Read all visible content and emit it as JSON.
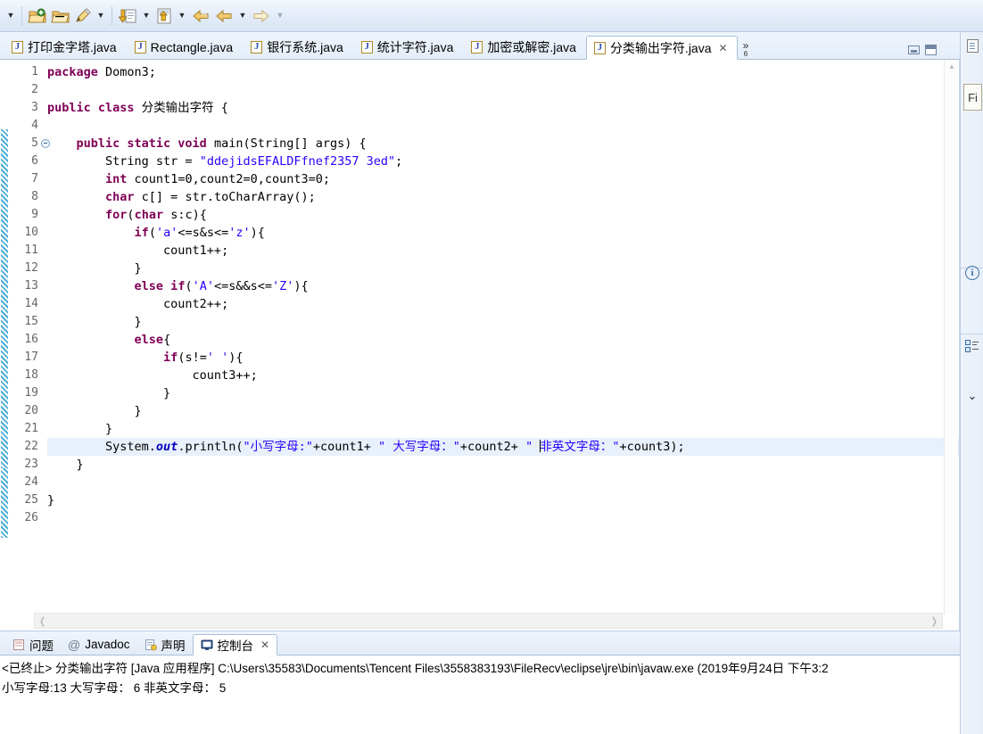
{
  "toolbar": {
    "items": [
      {
        "name": "dropdown-arrow",
        "icon": "caret-down"
      },
      {
        "name": "separator",
        "icon": "separator"
      },
      {
        "name": "new-wizard",
        "icon": "folder-new-icon"
      },
      {
        "name": "open-folder",
        "icon": "folder-open-icon"
      },
      {
        "name": "edit-pencil",
        "icon": "pencil-icon"
      },
      {
        "name": "edit-dropdown",
        "icon": "caret-down"
      },
      {
        "name": "separator",
        "icon": "separator"
      },
      {
        "name": "run-as",
        "icon": "run-download-icon"
      },
      {
        "name": "run-dropdown",
        "icon": "caret-down"
      },
      {
        "name": "external-tools",
        "icon": "tools-icon"
      },
      {
        "name": "external-dropdown",
        "icon": "caret-down"
      },
      {
        "name": "back-hand",
        "icon": "back-arrow-hand-icon"
      },
      {
        "name": "back-arrow",
        "icon": "back-arrow-icon"
      },
      {
        "name": "back-dropdown",
        "icon": "caret-down"
      },
      {
        "name": "forward-arrow",
        "icon": "forward-arrow-icon"
      },
      {
        "name": "forward-dropdown",
        "icon": "caret-down"
      }
    ]
  },
  "editor_tabs": {
    "tabs": [
      {
        "label": "打印金字塔.java",
        "active": false
      },
      {
        "label": "Rectangle.java",
        "active": false
      },
      {
        "label": "银行系统.java",
        "active": false
      },
      {
        "label": "统计字符.java",
        "active": false
      },
      {
        "label": "加密或解密.java",
        "active": false
      },
      {
        "label": "分类输出字符.java",
        "active": true
      }
    ],
    "close_glyph": "✕",
    "overflow_chevron": "»",
    "overflow_count": "6",
    "minimize_title": "最小化",
    "maximize_title": "最大化"
  },
  "editor": {
    "current_line": 22,
    "total_lines": 26,
    "line_numbers": [
      1,
      2,
      3,
      4,
      5,
      6,
      7,
      8,
      9,
      10,
      11,
      12,
      13,
      14,
      15,
      16,
      17,
      18,
      19,
      20,
      21,
      22,
      23,
      24,
      25,
      26
    ],
    "fold_marker_line": 5,
    "lines": [
      {
        "n": 1,
        "text": "package Domon3;"
      },
      {
        "n": 2,
        "text": ""
      },
      {
        "n": 3,
        "text": "public class 分类输出字符 {"
      },
      {
        "n": 4,
        "text": ""
      },
      {
        "n": 5,
        "text": "    public static void main(String[] args) {"
      },
      {
        "n": 6,
        "text": "        String str = \"ddejidsEFALDFfnef2357 3ed\";"
      },
      {
        "n": 7,
        "text": "        int count1=0,count2=0,count3=0;"
      },
      {
        "n": 8,
        "text": "        char c[] = str.toCharArray();"
      },
      {
        "n": 9,
        "text": "        for(char s:c){"
      },
      {
        "n": 10,
        "text": "            if('a'<=s&s<='z'){"
      },
      {
        "n": 11,
        "text": "                count1++;"
      },
      {
        "n": 12,
        "text": "            }"
      },
      {
        "n": 13,
        "text": "            else if('A'<=s&&s<='Z'){"
      },
      {
        "n": 14,
        "text": "                count2++;"
      },
      {
        "n": 15,
        "text": "            }"
      },
      {
        "n": 16,
        "text": "            else{"
      },
      {
        "n": 17,
        "text": "                if(s!=' '){"
      },
      {
        "n": 18,
        "text": "                    count3++;"
      },
      {
        "n": 19,
        "text": "                }"
      },
      {
        "n": 20,
        "text": "            }"
      },
      {
        "n": 21,
        "text": "        }"
      },
      {
        "n": 22,
        "text": "        System.out.println(\"小写字母:\"+count1+ \" 大写字母：\"+count2+ \" 非英文字母：\"+count3);"
      },
      {
        "n": 23,
        "text": "    }"
      },
      {
        "n": 24,
        "text": ""
      },
      {
        "n": 25,
        "text": "}"
      },
      {
        "n": 26,
        "text": ""
      }
    ],
    "scroll_left_glyph": "❬",
    "scroll_right_glyph": "❭",
    "scroll_up_glyph": "▲"
  },
  "bottom_panel": {
    "tabs": [
      {
        "label": "问题",
        "icon": "problems-icon",
        "active": false
      },
      {
        "label": "Javadoc",
        "icon": "at-icon",
        "active": false
      },
      {
        "label": "声明",
        "icon": "declaration-icon",
        "active": false
      },
      {
        "label": "控制台",
        "icon": "console-icon",
        "active": true
      }
    ],
    "close_glyph": "✕",
    "console": {
      "header": "<已终止> 分类输出字符 [Java 应用程序] C:\\Users\\35583\\Documents\\Tencent Files\\3558383193\\FileRecv\\eclipse\\jre\\bin\\javaw.exe  (2019年9月24日 下午3:2",
      "output": "小写字母:13 大写字母： 6 非英文字母： 5"
    }
  },
  "right_dock": {
    "items": [
      {
        "name": "document-icon",
        "label": ""
      },
      {
        "name": "file-label",
        "label": "Fi"
      },
      {
        "name": "info-icon",
        "label": "i"
      },
      {
        "name": "outline-icon",
        "label": ""
      },
      {
        "name": "chevron-down-icon",
        "label": "⌄"
      }
    ]
  },
  "colors": {
    "keyword": "#7f0055",
    "string": "#2a00ff",
    "field": "#0000c0",
    "plain": "#000000",
    "current_line_bg": "#e8f0fb",
    "chrome": "#e3ecf8",
    "border": "#a8bfd8"
  }
}
